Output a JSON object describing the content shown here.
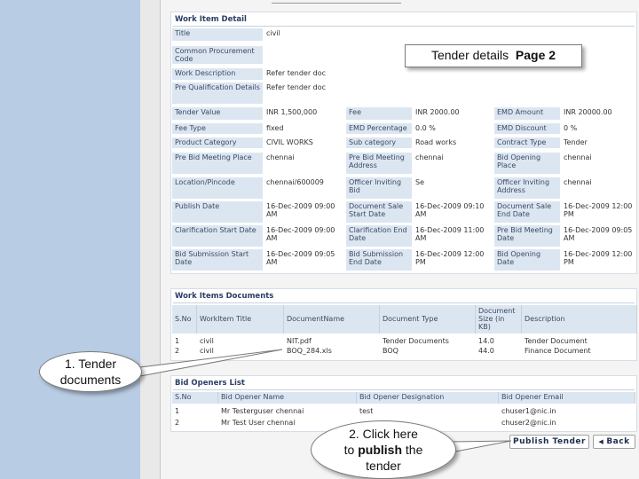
{
  "work_item_detail": {
    "title": "Work Item Detail",
    "left_rows": [
      {
        "label": "Title",
        "value": "civil"
      },
      {
        "label": "Common Procurement Code",
        "value": ""
      },
      {
        "label": "Work Description",
        "value": "Refer tender doc"
      },
      {
        "label": "Pre Qualification Details",
        "value": "Refer tender doc"
      },
      {
        "label": "Tender Value",
        "value": "INR 1,500,000"
      },
      {
        "label": "Fee Type",
        "value": "fixed"
      },
      {
        "label": "Product Category",
        "value": "CIVIL WORKS"
      },
      {
        "label": "Pre Bid Meeting Place",
        "value": "chennai"
      },
      {
        "label": "Location/Pincode",
        "value": "chennai/600009"
      },
      {
        "label": "Publish Date",
        "value": "16-Dec-2009 09:00 AM"
      },
      {
        "label": "Clarification Start Date",
        "value": "16-Dec-2009 09:00 AM"
      },
      {
        "label": "Bid Submission Start Date",
        "value": "16-Dec-2009 09:05 AM"
      }
    ],
    "mid_rows": [
      {
        "label": "Fee",
        "value": "INR 2000.00"
      },
      {
        "label": "EMD Percentage",
        "value": "0.0 %"
      },
      {
        "label": "Sub category",
        "value": "Road works"
      },
      {
        "label": "Pre Bid Meeting Address",
        "value": "chennai"
      },
      {
        "label": "Officer Inviting Bid",
        "value": "Se"
      },
      {
        "label": "Document Sale Start Date",
        "value": "16-Dec-2009 09:10 AM"
      },
      {
        "label": "Clarification End Date",
        "value": "16-Dec-2009 11:00 AM"
      },
      {
        "label": "Bid Submission End Date",
        "value": "16-Dec-2009 12:00 PM"
      }
    ],
    "right_rows": [
      {
        "label": "EMD Amount",
        "value": "INR 20000.00"
      },
      {
        "label": "EMD Discount",
        "value": "0 %"
      },
      {
        "label": "Contract Type",
        "value": "Tender"
      },
      {
        "label": "Bid Opening Place",
        "value": "chennai"
      },
      {
        "label": "Officer Inviting Address",
        "value": "chennai"
      },
      {
        "label": "Document Sale End Date",
        "value": "16-Dec-2009 12:00 PM"
      },
      {
        "label": "Pre Bid Meeting Date",
        "value": "16-Dec-2009 09:05 AM"
      },
      {
        "label": "Bid Opening Date",
        "value": "16-Dec-2009 12:00 PM"
      }
    ]
  },
  "work_items_documents": {
    "title": "Work Items Documents",
    "headers": [
      "S.No",
      "WorkItem Title",
      "DocumentName",
      "Document Type",
      "Document Size (in KB)",
      "Description"
    ],
    "rows": [
      [
        "1",
        "civil",
        "NIT.pdf",
        "Tender Documents",
        "14.0",
        "Tender Document"
      ],
      [
        "2",
        "civil",
        "BOQ_284.xls",
        "BOQ",
        "44.0",
        "Finance Document"
      ]
    ]
  },
  "bid_openers": {
    "title": "Bid Openers List",
    "headers": [
      "S.No",
      "Bid Opener Name",
      "Bid Opener Designation",
      "Bid Opener Email"
    ],
    "rows": [
      [
        "1",
        "Mr Testerguser chennai",
        "test",
        "chuser1@nic.in"
      ],
      [
        "2",
        "Mr Test User chennai",
        "",
        "chuser2@nic.in"
      ]
    ]
  },
  "buttons": {
    "publish": "Publish Tender",
    "back": "Back"
  },
  "callouts": {
    "tender_details_prefix": "Tender details",
    "tender_details_page": "Page 2",
    "tender_documents_line1": "1. Tender",
    "tender_documents_line2": "documents",
    "publish_line1": "2. Click here",
    "publish_line2a": "to ",
    "publish_line2b": "publish",
    "publish_line2c": " the",
    "publish_line3": "tender"
  }
}
